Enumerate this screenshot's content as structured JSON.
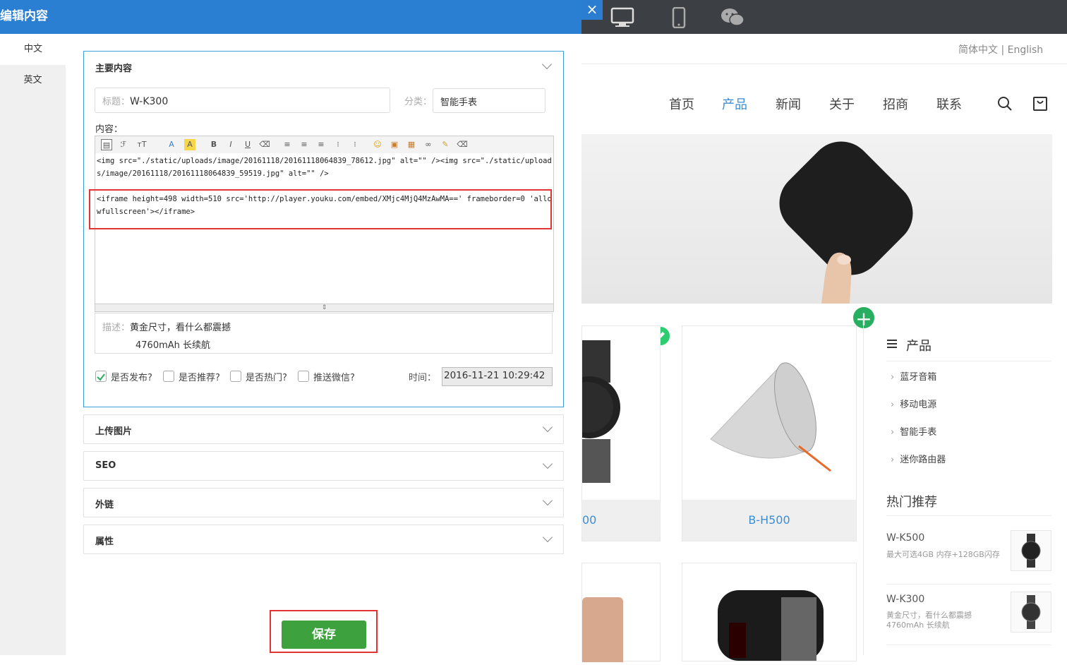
{
  "editor": {
    "title": "编辑内容",
    "lang_tabs": [
      "中文",
      "英文"
    ],
    "main_section": {
      "title": "主要内容",
      "title_label": "标题：",
      "title_value": "W-K300",
      "category_label": "分类：",
      "category_value": "智能手表",
      "content_label": "内容：",
      "code_line1": "<img src=\"./static/uploads/image/20161118/20161118064839_78612.jpg\" alt=\"\" /><img src=\"./static/uploads/image/20161118/20161118064839_59519.jpg\" alt=\"\" />",
      "code_line2": "<iframe height=498 width=510 src='http://player.youku.com/embed/XMjc4MjQ4MzAwMA==' frameborder=0 'allowfullscreen'></iframe>",
      "desc_label": "描述：",
      "desc_line1": "黄金尺寸，看什么都震撼",
      "desc_line2": "4760mAh 长续航",
      "checkboxes": [
        "是否发布?",
        "是否推荐?",
        "是否热门?",
        "推送微信?"
      ],
      "time_label": "时间：",
      "time_value": "2016-11-21 10:29:42"
    },
    "sections": [
      "上传图片",
      "SEO",
      "外链",
      "属性"
    ],
    "save_label": "保存"
  },
  "site": {
    "close_icon": "×",
    "lang_switch": "简体中文 | English",
    "nav": [
      "首页",
      "产品",
      "新闻",
      "关于",
      "招商",
      "联系"
    ],
    "product_cards": [
      "00",
      "B-H500"
    ],
    "sidebar": {
      "title": "产品",
      "categories": [
        "蓝牙音箱",
        "移动电源",
        "智能手表",
        "迷你路由器"
      ],
      "hot_title": "热门推荐",
      "hot_items": [
        {
          "name": "W-K500",
          "desc": "最大可选4GB 内存+128GB闪存"
        },
        {
          "name": "W-K300",
          "desc": "黄金尺寸，看什么都震撼 4760mAh 长续航"
        }
      ]
    }
  },
  "colors": {
    "accent": "#2b7fd3",
    "save": "#3da23d",
    "highlight": "#e23434",
    "active_nav": "#3b8ed6"
  }
}
